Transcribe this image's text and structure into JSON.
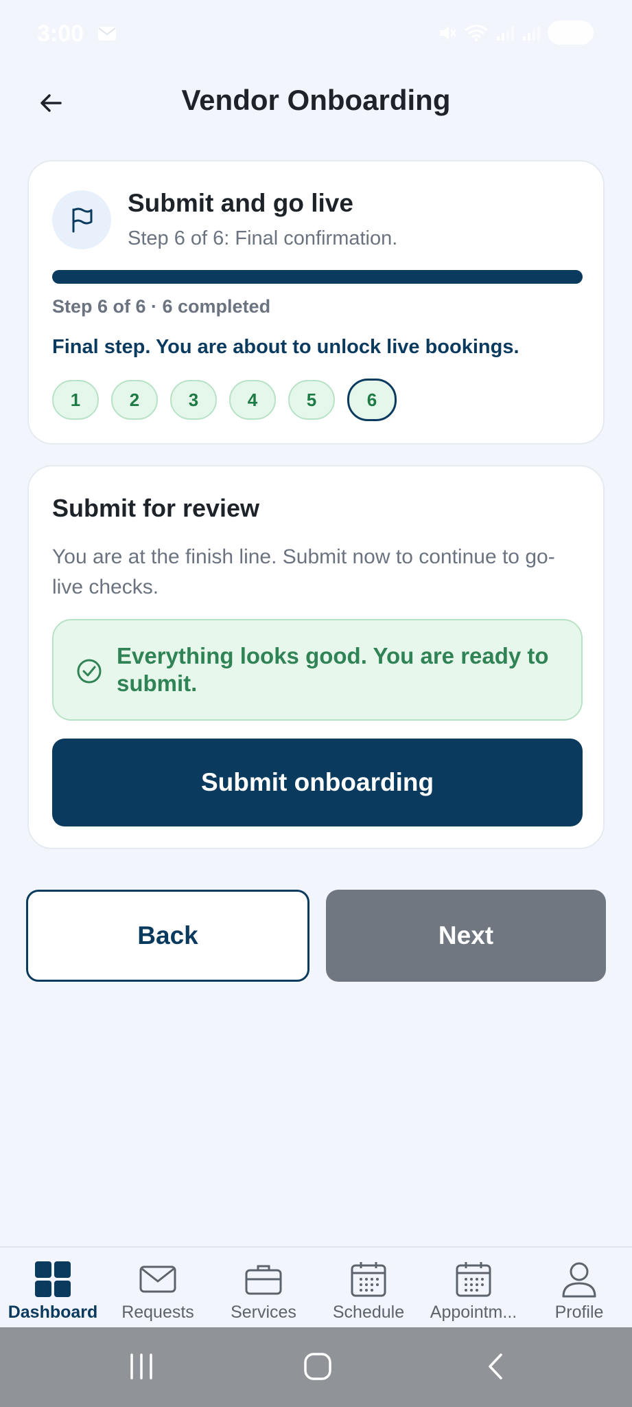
{
  "status_bar": {
    "time": "3:00",
    "battery": "100"
  },
  "header": {
    "title": "Vendor Onboarding"
  },
  "progress_card": {
    "title": "Submit and go live",
    "subtitle": "Step 6 of 6: Final confirmation.",
    "progress_fraction": 1.0,
    "step_count": "Step 6 of 6 · 6 completed",
    "final_note": "Final step. You are about to unlock live bookings.",
    "steps": [
      "1",
      "2",
      "3",
      "4",
      "5",
      "6"
    ],
    "current_step": "6"
  },
  "review_card": {
    "title": "Submit for review",
    "description": "You are at the finish line. Submit now to continue to go-live checks.",
    "success_message": "Everything looks good. You are ready to submit.",
    "submit_label": "Submit onboarding"
  },
  "navigation": {
    "back_label": "Back",
    "next_label": "Next"
  },
  "tab_bar": {
    "tabs": [
      {
        "label": "Dashboard",
        "icon": "dashboard-icon",
        "active": true
      },
      {
        "label": "Requests",
        "icon": "mail-icon",
        "active": false
      },
      {
        "label": "Services",
        "icon": "briefcase-icon",
        "active": false
      },
      {
        "label": "Schedule",
        "icon": "calendar-icon",
        "active": false
      },
      {
        "label": "Appointm...",
        "icon": "calendar-icon",
        "active": false
      },
      {
        "label": "Profile",
        "icon": "person-icon",
        "active": false
      }
    ]
  },
  "colors": {
    "primary": "#0b3a5f",
    "success_bg": "#e8f7ec",
    "success_text": "#2f8355",
    "disabled_button": "#717781",
    "background": "#f2f5fb"
  }
}
